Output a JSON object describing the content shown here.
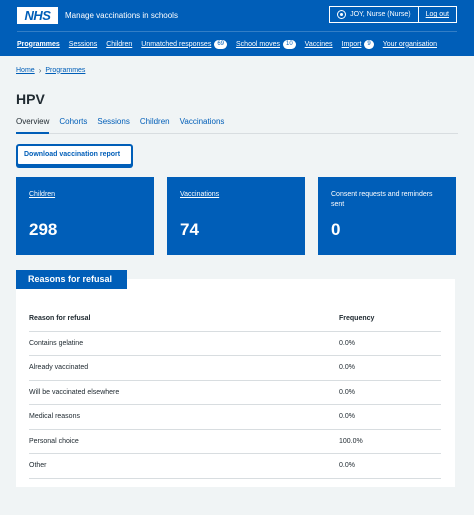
{
  "header": {
    "logo": "NHS",
    "service_name": "Manage vaccinations in schools",
    "user": "JOY, Nurse (Nurse)",
    "logout": "Log out"
  },
  "nav": [
    {
      "label": "Programmes",
      "active": true
    },
    {
      "label": "Sessions"
    },
    {
      "label": "Children"
    },
    {
      "label": "Unmatched responses",
      "badge": "69"
    },
    {
      "label": "School moves",
      "badge": "10"
    },
    {
      "label": "Vaccines"
    },
    {
      "label": "Import",
      "badge": "9"
    },
    {
      "label": "Your organisation"
    }
  ],
  "breadcrumb": [
    "Home",
    "Programmes"
  ],
  "page": {
    "title": "HPV",
    "tabs": [
      "Overview",
      "Cohorts",
      "Sessions",
      "Children",
      "Vaccinations"
    ],
    "active_tab": "Overview",
    "download_button": "Download vaccination report"
  },
  "cards": [
    {
      "label": "Children",
      "value": "298",
      "link": true
    },
    {
      "label": "Vaccinations",
      "value": "74",
      "link": true
    },
    {
      "label": "Consent requests and reminders sent",
      "value": "0",
      "link": false
    }
  ],
  "refusal": {
    "heading": "Reasons for refusal",
    "columns": [
      "Reason for refusal",
      "Frequency"
    ],
    "rows": [
      [
        "Contains gelatine",
        "0.0%"
      ],
      [
        "Already vaccinated",
        "0.0%"
      ],
      [
        "Will be vaccinated elsewhere",
        "0.0%"
      ],
      [
        "Medical reasons",
        "0.0%"
      ],
      [
        "Personal choice",
        "100.0%"
      ],
      [
        "Other",
        "0.0%"
      ]
    ]
  },
  "colors": {
    "brand": "#005eb8",
    "background": "#f0f4f5"
  }
}
